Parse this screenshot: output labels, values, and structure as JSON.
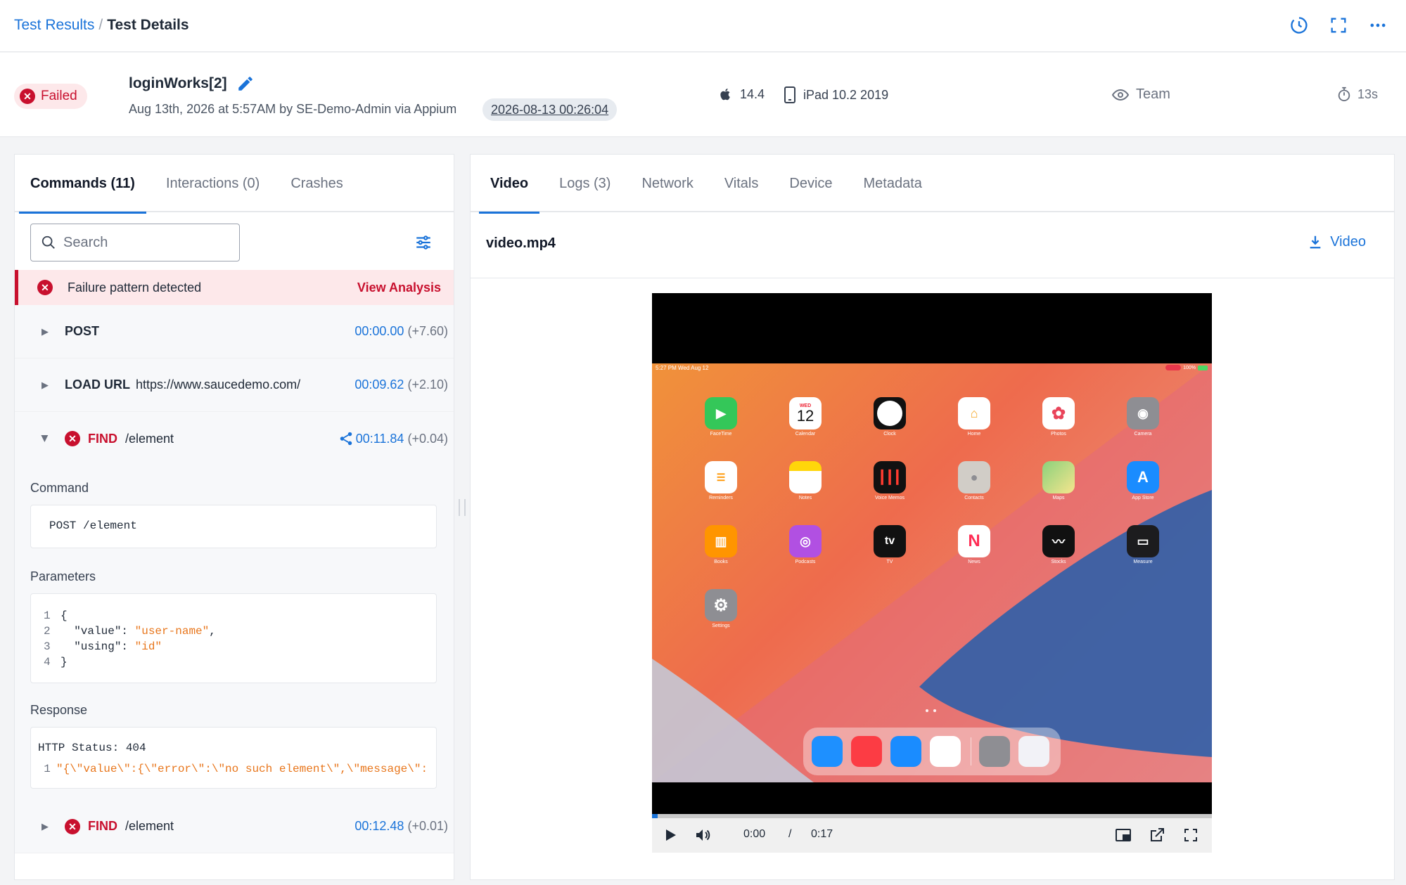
{
  "breadcrumb": {
    "parent": "Test Results",
    "separator": "/",
    "current": "Test Details"
  },
  "header": {
    "status": "Failed",
    "test_name": "loginWorks[2]",
    "meta": "Aug 13th, 2026 at 5:57AM by SE-Demo-Admin via Appium",
    "date_chip": "2026-08-13 00:26:04",
    "os_version": "14.4",
    "device": "iPad 10.2 2019",
    "visibility": "Team",
    "duration": "13s"
  },
  "left_tabs": [
    "Commands (11)",
    "Interactions (0)",
    "Crashes"
  ],
  "search": {
    "placeholder": "Search"
  },
  "failure": {
    "text": "Failure pattern detected",
    "link": "View Analysis"
  },
  "commands": [
    {
      "method": "POST",
      "path": "",
      "time": "00:00.00",
      "delta": "(+7.60)"
    },
    {
      "method": "LOAD URL",
      "path": "https://www.saucedemo.com/",
      "time": "00:09.62",
      "delta": "(+2.10)"
    },
    {
      "method": "FIND",
      "path": "/element",
      "time": "00:11.84",
      "delta": "(+0.04)"
    },
    {
      "method": "FIND",
      "path": "/element",
      "time": "00:12.48",
      "delta": "(+0.01)"
    }
  ],
  "detail": {
    "command_label": "Command",
    "command": "POST /element",
    "params_label": "Parameters",
    "params": [
      {
        "n": "1",
        "text": "{"
      },
      {
        "n": "2",
        "key": "\"value\"",
        "val": "\"user-name\"",
        "tail": ","
      },
      {
        "n": "3",
        "key": "\"using\"",
        "val": "\"id\"",
        "tail": ""
      },
      {
        "n": "4",
        "text": "}"
      }
    ],
    "response_label": "Response",
    "http_status": "HTTP Status: 404",
    "response_line_no": "1",
    "response_line": "\"{\\\"value\\\":{\\\"error\\\":\\\"no such element\\\",\\\"message\\\":"
  },
  "right_tabs": [
    "Video",
    "Logs (3)",
    "Network",
    "Vitals",
    "Device",
    "Metadata"
  ],
  "video": {
    "file": "video.mp4",
    "download_label": "Video",
    "current_time": "0:00",
    "time_sep": "/",
    "total_time": "0:17",
    "progress": 0.01
  },
  "ipad": {
    "status_left": "5:27 PM   Wed Aug 12",
    "status_right": "100%",
    "calendar_day": "WED",
    "calendar_date": "12",
    "apps": [
      "FaceTime",
      "Calendar",
      "Clock",
      "Home",
      "Photos",
      "Camera",
      "Reminders",
      "Notes",
      "Voice Memos",
      "Contacts",
      "Maps",
      "App Store",
      "Books",
      "Podcasts",
      "TV",
      "News",
      "Stocks",
      "Measure",
      "Settings"
    ]
  },
  "colors": {
    "accent": "#1a73d9",
    "danger": "#c8102e",
    "code_string": "#e8761c"
  }
}
